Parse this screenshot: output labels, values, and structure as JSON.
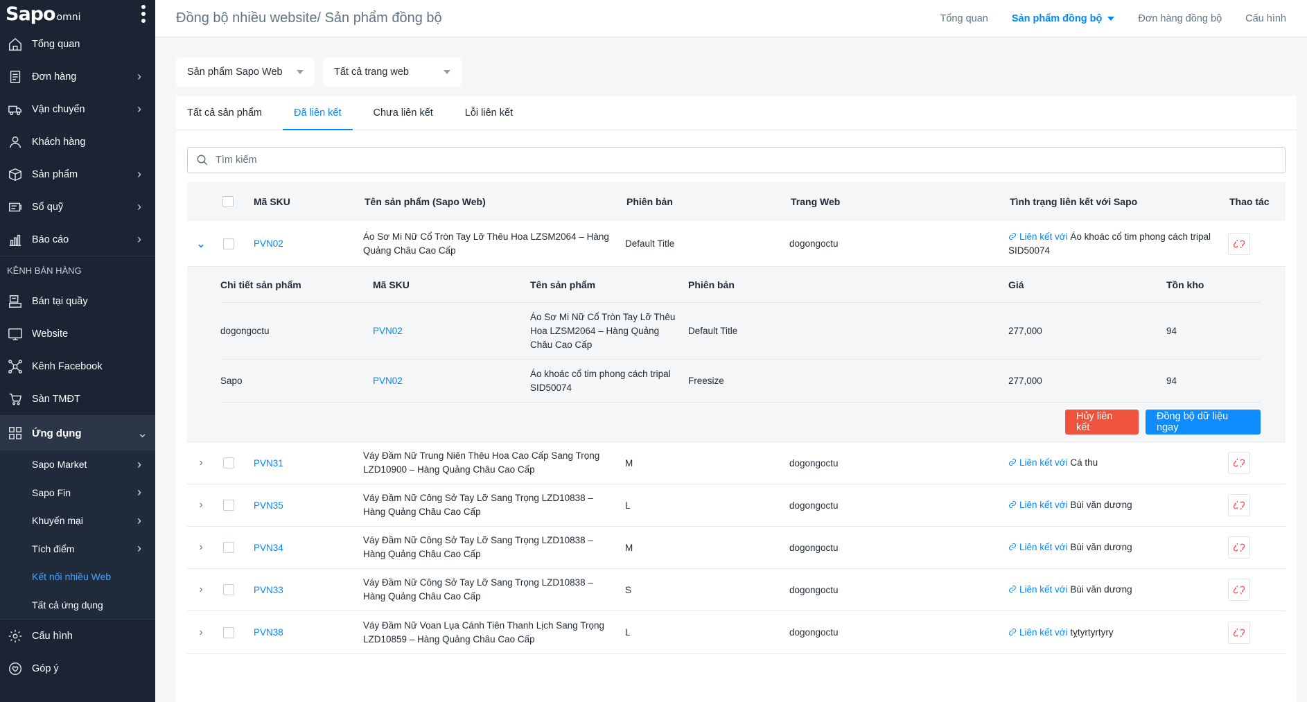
{
  "brand": {
    "logo": "Sapo",
    "logo_suffix": "omni"
  },
  "sidebar": {
    "items": [
      {
        "label": "Tổng quan",
        "icon": "home-icon",
        "has_chevron": false
      },
      {
        "label": "Đơn hàng",
        "icon": "orders-icon",
        "has_chevron": true
      },
      {
        "label": "Vận chuyển",
        "icon": "truck-icon",
        "has_chevron": true
      },
      {
        "label": "Khách hàng",
        "icon": "user-icon",
        "has_chevron": false
      },
      {
        "label": "Sản phẩm",
        "icon": "box-icon",
        "has_chevron": true
      },
      {
        "label": "Sổ quỹ",
        "icon": "cashbook-icon",
        "has_chevron": true
      },
      {
        "label": "Báo cáo",
        "icon": "report-icon",
        "has_chevron": true
      }
    ],
    "section_title": "KÊNH BÁN HÀNG",
    "channels": [
      {
        "label": "Bán tại quầy",
        "icon": "pos-icon"
      },
      {
        "label": "Website",
        "icon": "website-icon"
      },
      {
        "label": "Kênh Facebook",
        "icon": "facebook-channel-icon"
      },
      {
        "label": "Sàn TMĐT",
        "icon": "marketplace-icon"
      }
    ],
    "apps_group": {
      "label": "Ứng dụng",
      "icon": "apps-icon"
    },
    "apps": [
      {
        "label": "Sapo Market",
        "has_chevron": true
      },
      {
        "label": "Sapo Fin",
        "has_chevron": true
      },
      {
        "label": "Khuyến mại",
        "has_chevron": true
      },
      {
        "label": "Tích điểm",
        "has_chevron": true
      },
      {
        "label": "Kết nối nhiều Web",
        "has_chevron": false,
        "current": true
      },
      {
        "label": "Tất cả ứng dụng",
        "has_chevron": false
      }
    ],
    "bottom": [
      {
        "label": "Cấu hình",
        "icon": "gear-icon"
      },
      {
        "label": "Góp ý",
        "icon": "feedback-icon"
      }
    ]
  },
  "header": {
    "title": "Đồng bộ nhiều website/ Sản phẩm đồng bộ",
    "nav": [
      {
        "label": "Tổng quan",
        "active": false
      },
      {
        "label": "Sản phẩm đồng bộ",
        "active": true
      },
      {
        "label": "Đơn hàng đồng bộ",
        "active": false
      },
      {
        "label": "Cấu hình",
        "active": false
      }
    ]
  },
  "filters": {
    "product_source": "Sản phẩm Sapo Web",
    "website": "Tất cả trang web"
  },
  "tabs": [
    {
      "label": "Tất cả sản phẩm",
      "active": false
    },
    {
      "label": "Đã liên kết",
      "active": true
    },
    {
      "label": "Chưa liên kết",
      "active": false
    },
    {
      "label": "Lỗi liên kết",
      "active": false
    }
  ],
  "search": {
    "placeholder": "Tìm kiếm",
    "value": ""
  },
  "table": {
    "columns": [
      "Mã SKU",
      "Tên sản phẩm (Sapo Web)",
      "Phiên bản",
      "Trang Web",
      "Tình trạng liên kết với Sapo",
      "Thao tác"
    ],
    "link_prefix": "Liên kết với",
    "rows": [
      {
        "sku": "PVN02",
        "name": "Áo Sơ Mi Nữ Cổ Tròn Tay Lỡ Thêu Hoa LZSM2064 – Hàng Quảng Châu Cao Cấp",
        "variant": "Default Title",
        "site": "dogongoctu",
        "linked_to": "Áo khoác cổ tim phong cách tripal SID50074",
        "expanded": true
      },
      {
        "sku": "PVN31",
        "name": "Váy Đầm Nữ Trung Niên Thêu Hoa Cao Cấp Sang Trọng LZD10900 – Hàng Quảng Châu Cao Cấp",
        "variant": "M",
        "site": "dogongoctu",
        "linked_to": "Cá thu",
        "expanded": false
      },
      {
        "sku": "PVN35",
        "name": "Váy Đầm Nữ Công Sở Tay Lỡ Sang Trọng LZD10838 – Hàng Quảng Châu Cao Cấp",
        "variant": "L",
        "site": "dogongoctu",
        "linked_to": "Bùi văn dương",
        "expanded": false
      },
      {
        "sku": "PVN34",
        "name": "Váy Đầm Nữ Công Sở Tay Lỡ Sang Trọng LZD10838 – Hàng Quảng Châu Cao Cấp",
        "variant": "M",
        "site": "dogongoctu",
        "linked_to": "Bùi văn dương",
        "expanded": false
      },
      {
        "sku": "PVN33",
        "name": "Váy Đầm Nữ Công Sở Tay Lỡ Sang Trọng LZD10838 – Hàng Quảng Châu Cao Cấp",
        "variant": "S",
        "site": "dogongoctu",
        "linked_to": "Bùi văn dương",
        "expanded": false
      },
      {
        "sku": "PVN38",
        "name": "Váy Đầm Nữ Voan Lụa Cánh Tiên Thanh Lịch Sang Trọng LZD10859 – Hàng Quảng Châu Cao Cấp",
        "variant": "L",
        "site": "dogongoctu",
        "linked_to": "tỵtyrtyrtyry",
        "expanded": false
      }
    ]
  },
  "detail": {
    "columns": [
      "Chi tiết sản phẩm",
      "Mã SKU",
      "Tên sản phẩm",
      "Phiên bản",
      "Giá",
      "Tồn kho"
    ],
    "rows": [
      {
        "source": "dogongoctu",
        "sku": "PVN02",
        "name": "Áo Sơ Mi Nữ Cổ Tròn Tay Lỡ Thêu Hoa LZSM2064 – Hàng Quảng Châu Cao Cấp",
        "variant": "Default Title",
        "price": "277,000",
        "stock": "94"
      },
      {
        "source": "Sapo",
        "sku": "PVN02",
        "name": "Áo khoác cổ tim phong cách tripal SID50074",
        "variant": "Freesize",
        "price": "277,000",
        "stock": "94"
      }
    ],
    "unlink_label": "Hủy liên kết",
    "sync_label": "Đồng bộ dữ liệu ngay"
  },
  "colors": {
    "primary": "#0088ff",
    "danger": "#f0533d",
    "sidebar": "#1b2433"
  }
}
